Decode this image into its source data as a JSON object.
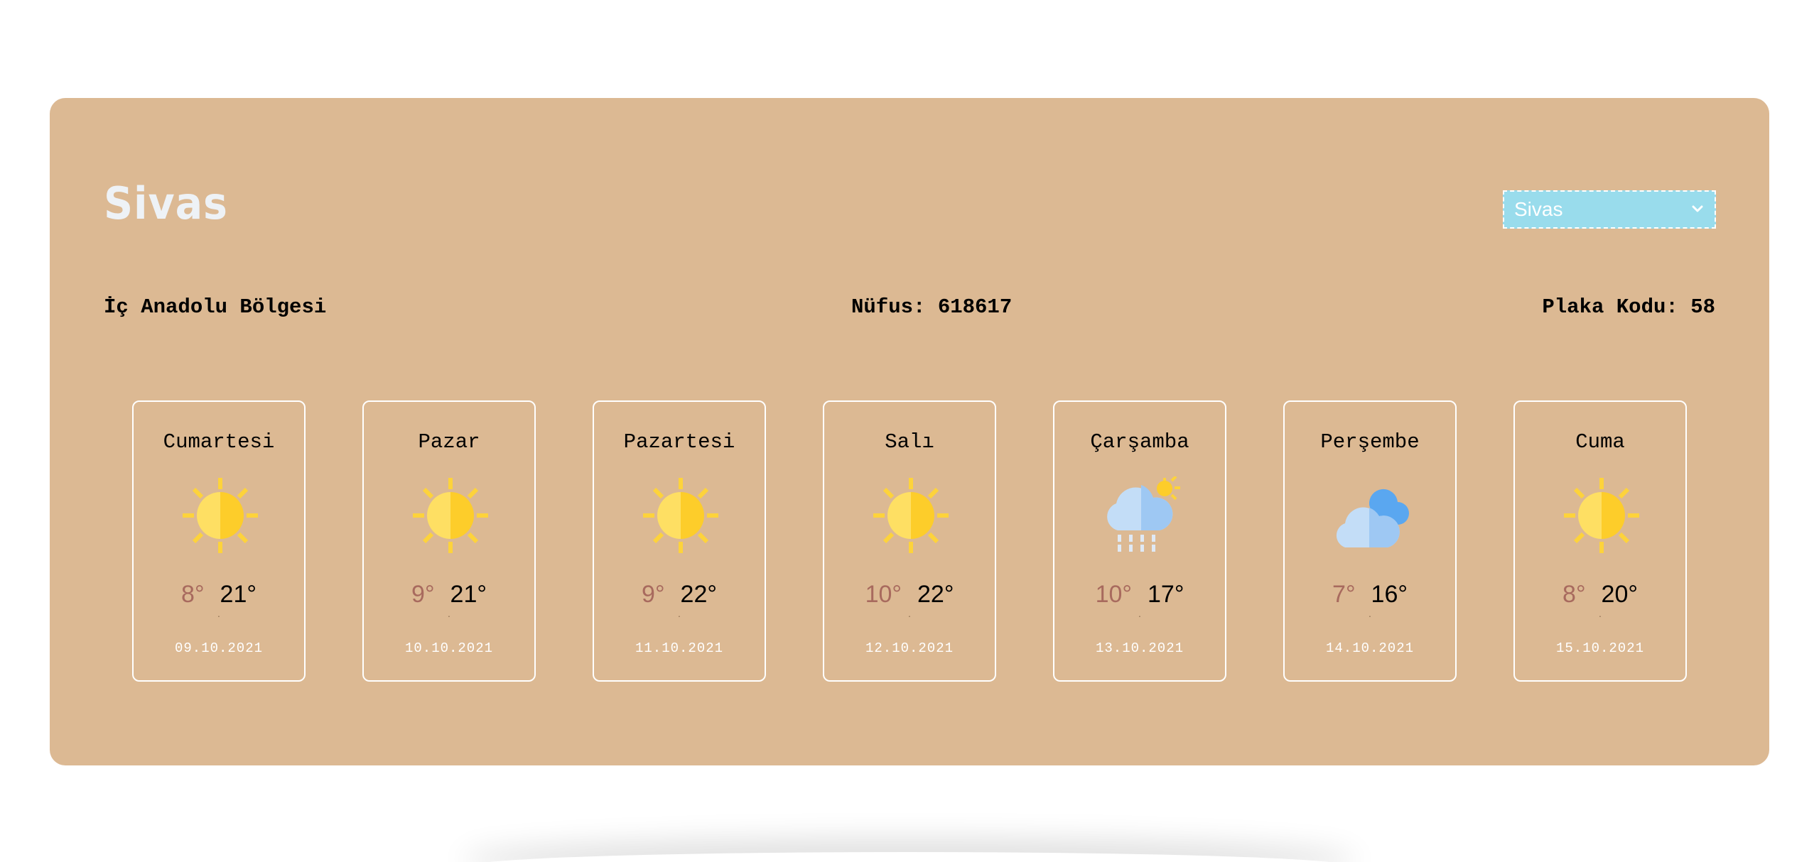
{
  "city": {
    "title": "Sivas",
    "region": "İç Anadolu Bölgesi",
    "population": "Nüfus: 618617",
    "plate": "Plaka Kodu: 58"
  },
  "select": {
    "value": "Sivas"
  },
  "forecast": [
    {
      "day": "Cumartesi",
      "min": "8°",
      "max": "21°",
      "date": "09.10.2021",
      "icon": "sun-icon"
    },
    {
      "day": "Pazar",
      "min": "9°",
      "max": "21°",
      "date": "10.10.2021",
      "icon": "sun-icon"
    },
    {
      "day": "Pazartesi",
      "min": "9°",
      "max": "22°",
      "date": "11.10.2021",
      "icon": "sun-icon"
    },
    {
      "day": "Salı",
      "min": "10°",
      "max": "22°",
      "date": "12.10.2021",
      "icon": "sun-icon"
    },
    {
      "day": "Çarşamba",
      "min": "10°",
      "max": "17°",
      "date": "13.10.2021",
      "icon": "rain-cloud-sun-icon"
    },
    {
      "day": "Perşembe",
      "min": "7°",
      "max": "16°",
      "date": "14.10.2021",
      "icon": "cloudy-icon"
    },
    {
      "day": "Cuma",
      "min": "8°",
      "max": "20°",
      "date": "15.10.2021",
      "icon": "sun-icon"
    }
  ],
  "colors": {
    "panel": "#dcb993",
    "select_bg": "#99dcec",
    "min_temp": "#a86a5e",
    "sun": "#fdd33b"
  }
}
